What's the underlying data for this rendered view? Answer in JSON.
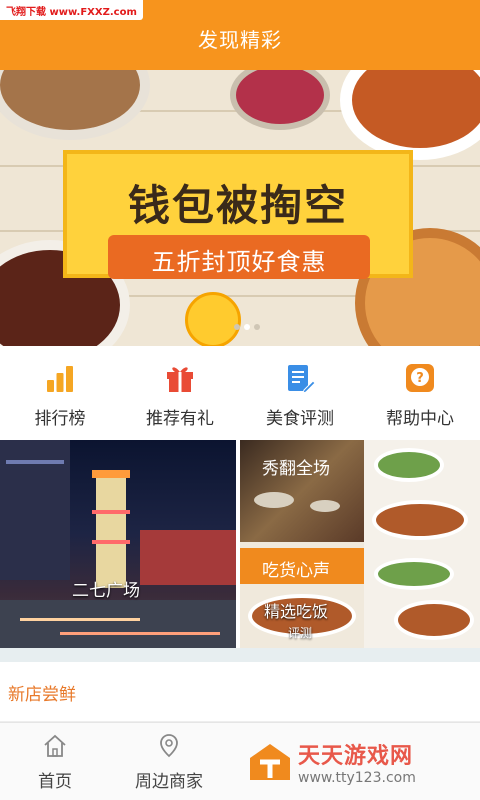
{
  "watermark": "飞翔下载 www.FXXZ.com",
  "header": {
    "title": "发现精彩"
  },
  "banner": {
    "headline": "钱包被掏空",
    "subline": "五折封顶好食惠",
    "page_count": 3,
    "active_page": 1
  },
  "quick_nav": [
    {
      "label": "排行榜",
      "icon": "bar-chart-icon",
      "color": "#f5a623"
    },
    {
      "label": "推荐有礼",
      "icon": "gift-icon",
      "color": "#e94b35"
    },
    {
      "label": "美食评测",
      "icon": "note-edit-icon",
      "color": "#3a8ee6"
    },
    {
      "label": "帮助中心",
      "icon": "question-icon",
      "color": "#f08a1e"
    }
  ],
  "featured": {
    "left": {
      "label": "二七广场"
    },
    "right": [
      {
        "label": "秀翻全场"
      },
      {
        "label": "吃货心声"
      },
      {
        "label": "精选吃饭"
      },
      {
        "label": "评测"
      }
    ]
  },
  "section": {
    "title": "新店尝鲜"
  },
  "tabbar": [
    {
      "label": "首页",
      "icon": "home-icon"
    },
    {
      "label": "周边商家",
      "icon": "location-pin-icon"
    }
  ],
  "brand": {
    "name": "天天游戏网",
    "url": "www.tty123.com"
  },
  "colors": {
    "accent": "#f7941d",
    "section_title": "#e8792a"
  }
}
